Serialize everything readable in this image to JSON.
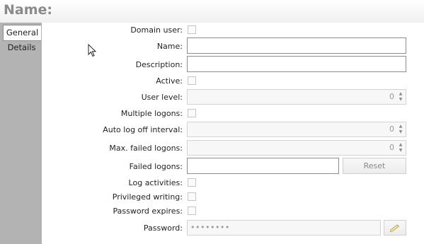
{
  "header": {
    "title": "Name:"
  },
  "tabs": [
    {
      "label": "General"
    },
    {
      "label": "Details"
    }
  ],
  "form": {
    "domain_user_label": "Domain user:",
    "name_label": "Name:",
    "name_value": "",
    "description_label": "Description:",
    "description_value": "",
    "active_label": "Active:",
    "user_level_label": "User level:",
    "user_level_value": "0",
    "multiple_logons_label": "Multiple logons:",
    "auto_log_off_label": "Auto log off interval:",
    "auto_log_off_value": "0",
    "max_failed_logons_label": "Max. failed logons:",
    "max_failed_logons_value": "0",
    "failed_logons_label": "Failed logons:",
    "failed_logons_value": "",
    "reset_button": "Reset",
    "log_activities_label": "Log activities:",
    "privileged_writing_label": "Privileged writing:",
    "password_expires_label": "Password expires:",
    "password_label": "Password:",
    "password_value": "••••••••"
  },
  "icons": {
    "spin_up": "spin-up-icon",
    "spin_down": "spin-down-icon",
    "edit_password": "pencil-icon",
    "cursor": "mouse-pointer-icon"
  },
  "colors": {
    "sidebar": "#b3b3b3",
    "title": "#8a8a8a",
    "field_border": "#8d8d8d",
    "disabled_border": "#d3d3d3"
  }
}
